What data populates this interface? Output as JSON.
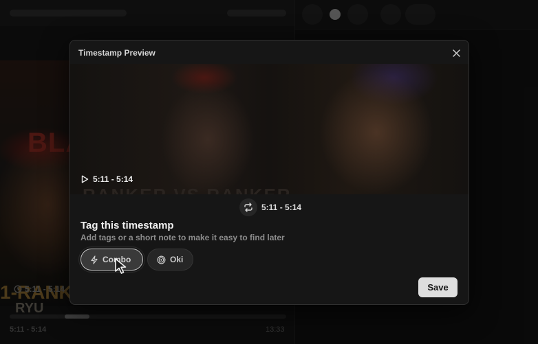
{
  "background": {
    "thumb_title": "BLA",
    "thumb_rank": "1-RANK",
    "thumb_name": "RYU",
    "time_chip": "5:11 - 5:14",
    "timeline_start": "5:11 - 5:14",
    "timeline_end": "13:33"
  },
  "modal": {
    "title": "Timestamp Preview",
    "preview_banner": "RANKER  VS  RANKER",
    "preview_time": "5:11 - 5:14",
    "range_text": "5:11 - 5:14",
    "tag_title": "Tag this timestamp",
    "tag_subtitle": "Add tags or a short note to make it easy to find later",
    "tags": [
      {
        "label": "Combo",
        "icon": "lightning-icon",
        "selected": true
      },
      {
        "label": "Oki",
        "icon": "target-icon",
        "selected": false
      }
    ],
    "save_label": "Save"
  },
  "colors": {
    "modal_bg": "#161616",
    "save_bg": "#dedede",
    "chip_selected_border": "#bdbdbd"
  }
}
